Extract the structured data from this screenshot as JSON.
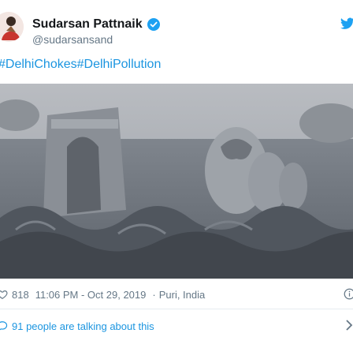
{
  "tweet": {
    "display_name": "Sudarsan Pattnaik",
    "handle": "@sudarsansand",
    "hashtags": [
      "#DelhiChokes",
      "#DelhiPollution"
    ],
    "likes": "818",
    "time": "11:06 PM - Oct 29, 2019",
    "separator": "·",
    "location": "Puri, India",
    "talking": "91 people are talking about this"
  },
  "colors": {
    "link": "#1b95e0",
    "muted": "#657786",
    "verified": "#1da1f2"
  },
  "icons": [
    "avatar",
    "verified-badge-icon",
    "twitter-bird-icon",
    "heart-icon",
    "info-icon",
    "speech-bubble-icon",
    "chevron-right-icon"
  ]
}
